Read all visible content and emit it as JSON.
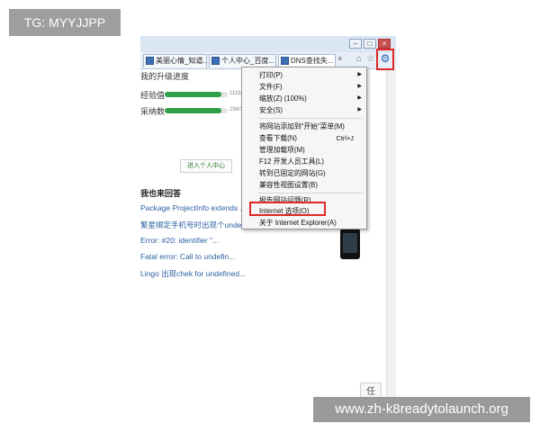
{
  "watermarks": {
    "top_left": "TG: MYYJJPP",
    "bottom_right": "www.zh-k8readytolaunch.org"
  },
  "browser": {
    "tabs": [
      {
        "label": "美丽心情_知道..."
      },
      {
        "label": "个人中心_百度..."
      },
      {
        "label": "DNS查找失..."
      }
    ],
    "tab_close": "×",
    "window_buttons": {
      "minimize": "–",
      "maximize": "□",
      "close": "×"
    },
    "icons": {
      "home": "home-icon",
      "star": "star-icon",
      "gear": "gear-icon"
    }
  },
  "page": {
    "header_partial": "我的升级进度",
    "progress": [
      {
        "label": "经验值",
        "number": "1119/",
        "fraction": 0.9
      },
      {
        "label": "采纳数",
        "number": "298/3",
        "fraction": 0.9
      }
    ],
    "center_button": "进入个人中心",
    "section_title": "我也来回答",
    "questions": [
      "Package ProjectInfo extends ...",
      "繁星绑定手机号时出现个undefi...",
      "Error: #20: identifier \"...",
      "Fatal error: Call to undefin...",
      "Lingo 出现chek for undefined..."
    ],
    "corner_button": "任"
  },
  "tools_menu": {
    "items": [
      {
        "label": "打印(P)",
        "submenu": true
      },
      {
        "label": "文件(F)",
        "submenu": true
      },
      {
        "label": "缩放(Z) (100%)",
        "submenu": true
      },
      {
        "label": "安全(S)",
        "submenu": true
      },
      {
        "label": "将网站添加到“开始”菜单(M)"
      },
      {
        "label": "查看下载(N)",
        "shortcut": "Ctrl+J"
      },
      {
        "label": "管理加载项(M)"
      },
      {
        "label": "F12 开发人员工具(L)"
      },
      {
        "label": "转到已固定的网站(G)"
      },
      {
        "label": "兼容性视图设置(B)"
      },
      {
        "label": "报告网站问题(R)"
      },
      {
        "label": "Internet 选项(O)"
      },
      {
        "label": "关于 Internet Explorer(A)"
      }
    ]
  }
}
